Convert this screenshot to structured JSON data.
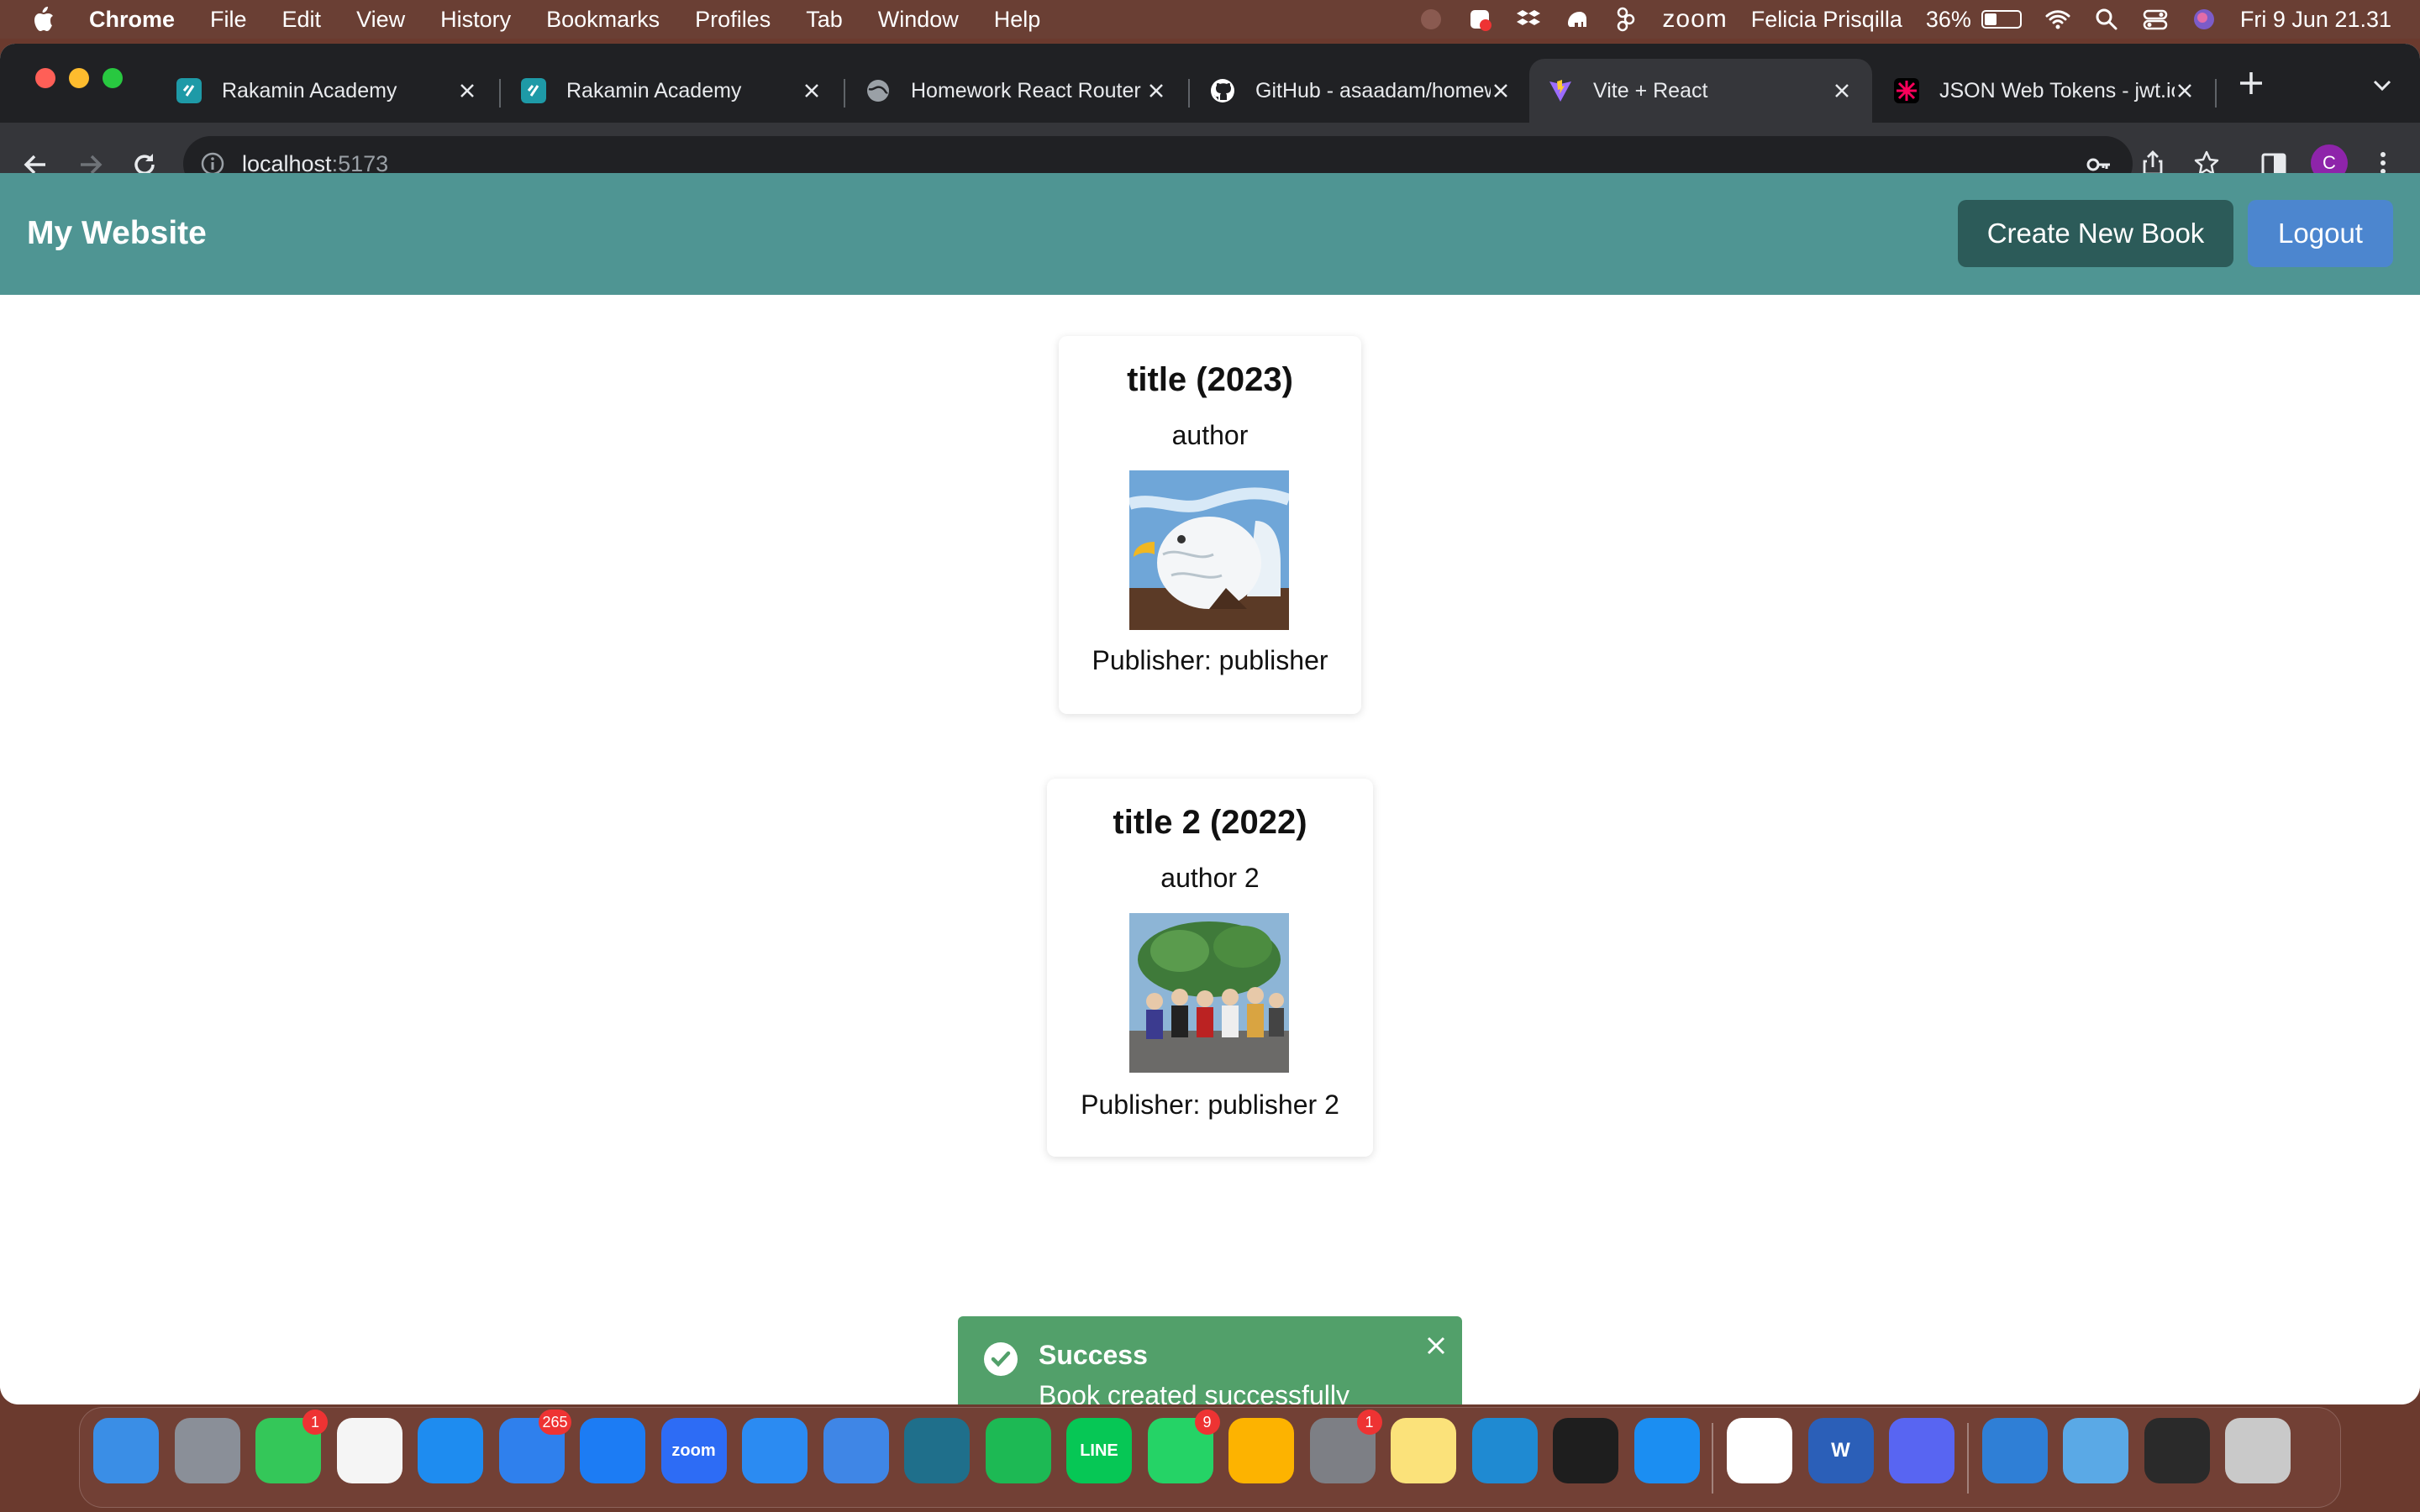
{
  "menubar": {
    "app_name": "Chrome",
    "items": [
      "File",
      "Edit",
      "View",
      "History",
      "Bookmarks",
      "Profiles",
      "Tab",
      "Window",
      "Help"
    ],
    "zoom_label": "zoom",
    "user_name": "Felicia Prisqilla",
    "battery_percent": "36%",
    "battery_level": 0.36,
    "datetime": "Fri 9 Jun  21.31"
  },
  "browser": {
    "tabs": [
      {
        "title": "Rakamin Academy",
        "icon": "rakamin-favicon",
        "active": false
      },
      {
        "title": "Rakamin Academy",
        "icon": "rakamin-favicon",
        "active": false
      },
      {
        "title": "Homework React Router",
        "icon": "globe-favicon",
        "active": false
      },
      {
        "title": "GitHub - asaadam/homew",
        "icon": "github-favicon",
        "active": false
      },
      {
        "title": "Vite + React",
        "icon": "vite-favicon",
        "active": true
      },
      {
        "title": "JSON Web Tokens - jwt.io",
        "icon": "jwt-favicon",
        "active": false
      }
    ],
    "url_host": "localhost",
    "url_port": ":5173",
    "profile_initial": "C"
  },
  "page": {
    "navbar": {
      "brand": "My Website",
      "create_button": "Create New Book",
      "logout_button": "Logout"
    },
    "books": [
      {
        "title": "title (2023)",
        "author": "author",
        "publisher": "Publisher: publisher",
        "cover": "eagle-illustration"
      },
      {
        "title": "title 2 (2022)",
        "author": "author 2",
        "publisher": "Publisher: publisher 2",
        "cover": "group-photo-illustration"
      }
    ],
    "toast": {
      "title": "Success",
      "description": "Book created successfully",
      "status": "success"
    }
  },
  "dock": {
    "items": [
      {
        "name": "Finder",
        "icon": "finder-icon",
        "color": "#3a8ee6"
      },
      {
        "name": "Launchpad",
        "icon": "launchpad-icon",
        "color": "#8a8f98"
      },
      {
        "name": "Messages",
        "icon": "messages-icon",
        "color": "#34c759",
        "badge": "1"
      },
      {
        "name": "Photos",
        "icon": "photos-icon",
        "color": "#f5f5f5"
      },
      {
        "name": "Keynote",
        "icon": "keynote-icon",
        "color": "#1e8cf0"
      },
      {
        "name": "Mail",
        "icon": "mail-icon",
        "color": "#2f80ed",
        "badge": "265"
      },
      {
        "name": "App Store",
        "icon": "app-store-icon",
        "color": "#1c7cf4"
      },
      {
        "name": "Zoom",
        "icon": "zoom-icon",
        "color": "#2d6cf5",
        "text": "zoom"
      },
      {
        "name": "Xcode",
        "icon": "xcode-icon",
        "color": "#2b8bf2"
      },
      {
        "name": "Simulator",
        "icon": "simulator-icon",
        "color": "#3f86e6"
      },
      {
        "name": "Mendeley",
        "icon": "mendeley-icon",
        "color": "#1f6f8b"
      },
      {
        "name": "Spotify",
        "icon": "spotify-icon",
        "color": "#1db954"
      },
      {
        "name": "LINE",
        "icon": "line-icon",
        "color": "#06c755",
        "text": "LINE"
      },
      {
        "name": "WhatsApp",
        "icon": "whatsapp-icon",
        "color": "#25d366",
        "badge": "9"
      },
      {
        "name": "Sketch",
        "icon": "sketch-icon",
        "color": "#fdb300"
      },
      {
        "name": "System Settings",
        "icon": "settings-icon",
        "color": "#7d7f85",
        "badge": "1"
      },
      {
        "name": "Notes",
        "icon": "notes-icon",
        "color": "#fbe27a"
      },
      {
        "name": "VS Code",
        "icon": "vscode-icon",
        "color": "#1f8ad2"
      },
      {
        "name": "Figma",
        "icon": "figma-icon",
        "color": "#1e1e1e"
      },
      {
        "name": "Safari",
        "icon": "safari-icon",
        "color": "#1b8ef2"
      },
      {
        "name": "Chrome",
        "icon": "chrome-icon",
        "color": "#ffffff"
      },
      {
        "name": "Word",
        "icon": "word-icon",
        "color": "#2b5fb8",
        "text": "W"
      },
      {
        "name": "Discord",
        "icon": "discord-icon",
        "color": "#5865f2"
      },
      {
        "name": "Network",
        "icon": "globe-icon",
        "color": "#2f7fd6"
      },
      {
        "name": "Downloads",
        "icon": "downloads-folder-icon",
        "color": "#5aa9e6"
      },
      {
        "name": "Screenshots",
        "icon": "screenshots-icon",
        "color": "#2a2a2a"
      },
      {
        "name": "Trash",
        "icon": "trash-icon",
        "color": "#c9c9c9"
      }
    ]
  }
}
